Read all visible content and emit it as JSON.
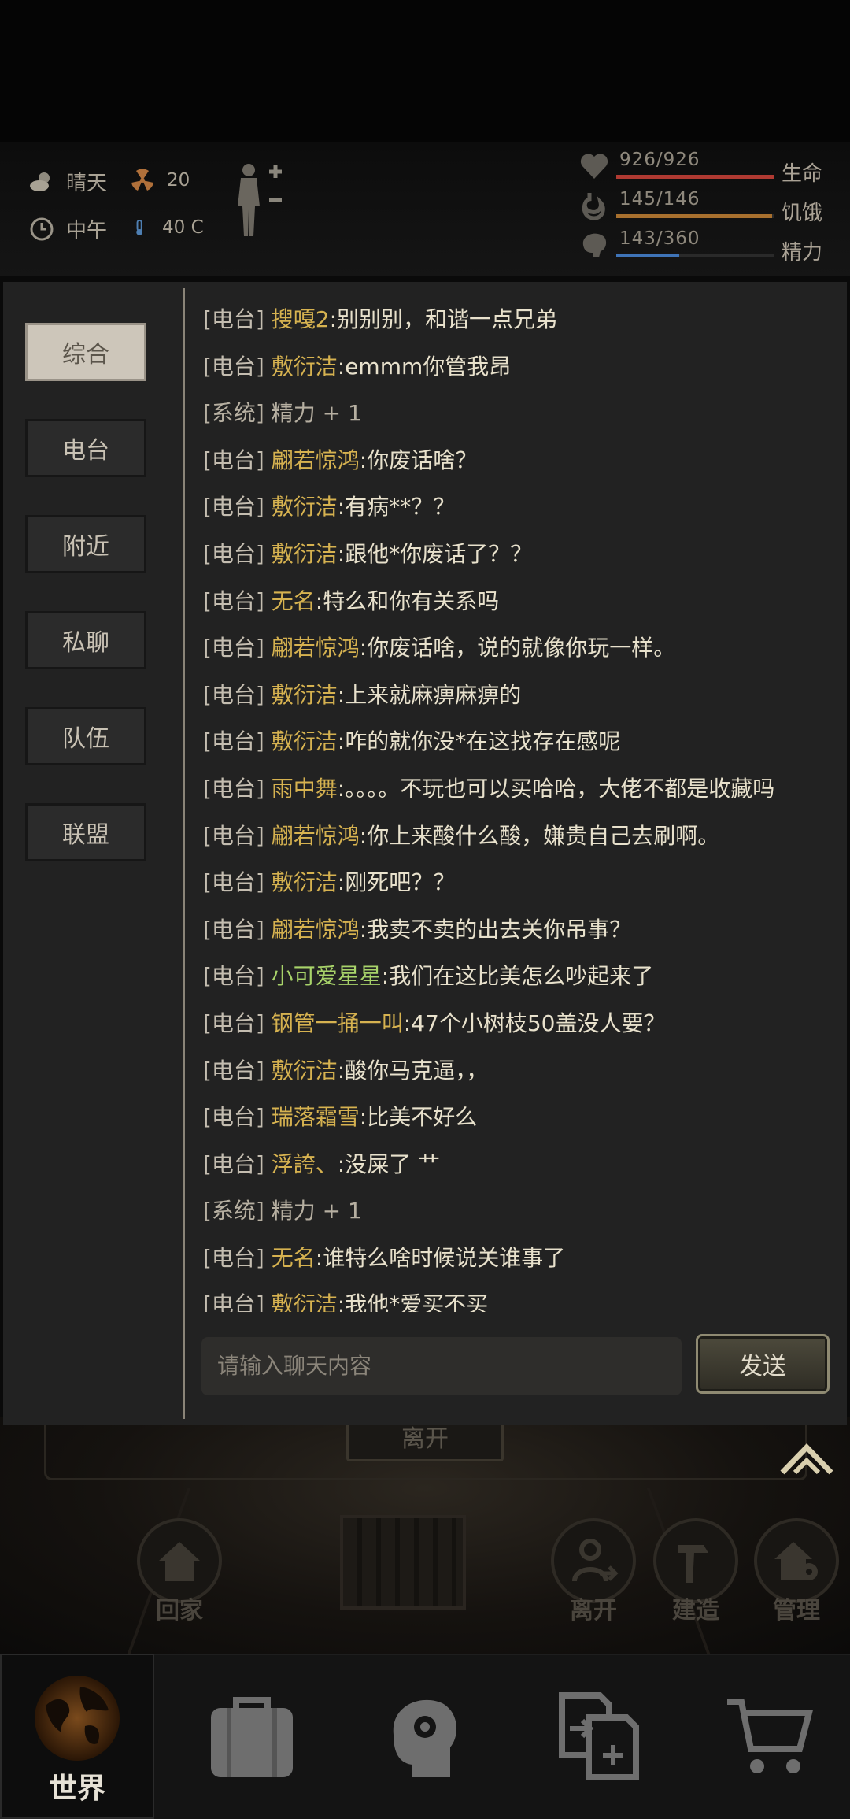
{
  "status": {
    "weather": "晴天",
    "radiation": "20",
    "time_of_day": "中午",
    "temperature": "40 C",
    "health": {
      "value": "926/926",
      "label": "生命",
      "fraction": 1.0,
      "color": "#b03a32"
    },
    "hunger": {
      "value": "145/146",
      "label": "饥饿",
      "fraction": 0.99,
      "color": "#a8702e"
    },
    "energy": {
      "value": "143/360",
      "label": "精力",
      "fraction": 0.4,
      "color": "#3f74b8"
    }
  },
  "chat": {
    "tabs": [
      {
        "label": "综合",
        "active": true
      },
      {
        "label": "电台",
        "active": false
      },
      {
        "label": "附近",
        "active": false
      },
      {
        "label": "私聊",
        "active": false
      },
      {
        "label": "队伍",
        "active": false
      },
      {
        "label": "联盟",
        "active": false
      }
    ],
    "messages": [
      {
        "tag": "[电台]",
        "name": "搜嘎2",
        "text": ":别别别，和谐一点兄弟"
      },
      {
        "tag": "[电台]",
        "name": "敷衍洁",
        "text": ":emmm你管我昂"
      },
      {
        "tag": "[系统]",
        "name": "",
        "text": "精力 + 1",
        "system": true
      },
      {
        "tag": "[电台]",
        "name": "翩若惊鸿",
        "text": ":你废话啥？"
      },
      {
        "tag": "[电台]",
        "name": "敷衍洁",
        "text": ":有病**？？"
      },
      {
        "tag": "[电台]",
        "name": "敷衍洁",
        "text": ":跟他*你废话了？？"
      },
      {
        "tag": "[电台]",
        "name": "无名",
        "text": ":特么和你有关系吗"
      },
      {
        "tag": "[电台]",
        "name": "翩若惊鸿",
        "text": ":你废话啥，说的就像你玩一样。"
      },
      {
        "tag": "[电台]",
        "name": "敷衍洁",
        "text": ":上来就麻痹麻痹的"
      },
      {
        "tag": "[电台]",
        "name": "敷衍洁",
        "text": ":咋的就你没*在这找存在感呢"
      },
      {
        "tag": "[电台]",
        "name": "雨中舞",
        "text": ":。。。。不玩也可以买哈哈，大佬不都是收藏吗"
      },
      {
        "tag": "[电台]",
        "name": "翩若惊鸿",
        "text": ":你上来酸什么酸，嫌贵自己去刷啊。"
      },
      {
        "tag": "[电台]",
        "name": "敷衍洁",
        "text": ":刚死吧？？"
      },
      {
        "tag": "[电台]",
        "name": "翩若惊鸿",
        "text": ":我卖不卖的出去关你吊事？"
      },
      {
        "tag": "[电台]",
        "name": "小可爱星星",
        "text": ":我们在这比美怎么吵起来了",
        "green": true
      },
      {
        "tag": "[电台]",
        "name": "钢管一捅一叫",
        "text": ":47个小树枝50盖没人要？"
      },
      {
        "tag": "[电台]",
        "name": "敷衍洁",
        "text": ":酸你马克逼，，"
      },
      {
        "tag": "[电台]",
        "name": "瑞落霜雪",
        "text": ":比美不好么"
      },
      {
        "tag": "[电台]",
        "name": "浮誇、",
        "text": ":没屎了 艹"
      },
      {
        "tag": "[系统]",
        "name": "",
        "text": "精力 + 1",
        "system": true
      },
      {
        "tag": "[电台]",
        "name": "无名",
        "text": ":谁特么啥时候说关谁事了"
      },
      {
        "tag": "[电台]",
        "name": "敷衍洁",
        "text": ":我他*爱买不买"
      }
    ],
    "input_placeholder": "请输入聊天内容",
    "send_label": "发送"
  },
  "scene": {
    "leave_button": "离开",
    "buttons": [
      {
        "label": "回家",
        "icon": "home-icon"
      },
      {
        "label": "离开",
        "icon": "leave-icon"
      },
      {
        "label": "建造",
        "icon": "hammer-icon"
      },
      {
        "label": "管理",
        "icon": "gear-house-icon"
      }
    ]
  },
  "nav": {
    "world_label": "世界",
    "items": [
      "world-globe-icon",
      "backpack-icon",
      "head-gear-icon",
      "exchange-icon",
      "cart-icon"
    ]
  }
}
